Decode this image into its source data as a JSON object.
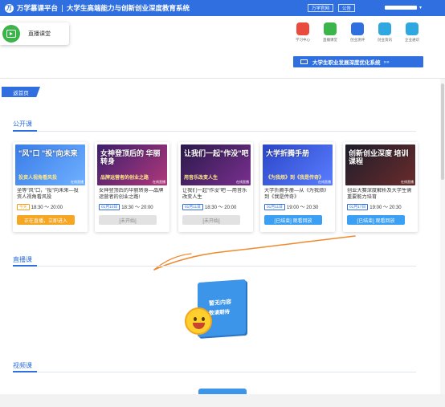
{
  "topbar": {
    "logo_letter": "万",
    "brand": "万学慕课平台",
    "system": "大学生高端能力与创新创业深度教育系统",
    "btn_site": "万学官网",
    "btn_notice": "公告"
  },
  "header": {
    "classroom_label": "直播课堂",
    "nav": [
      {
        "label": "学习中心",
        "color": "#e94b3c",
        "icon": "learning-center-icon"
      },
      {
        "label": "直播课堂",
        "color": "#39b54a",
        "icon": "live-classroom-icon"
      },
      {
        "label": "创业测评",
        "color": "#2f6fe0",
        "icon": "assessment-icon"
      },
      {
        "label": "创业资讯",
        "color": "#2fa7e0",
        "icon": "news-icon"
      },
      {
        "label": "企业通识",
        "color": "#2fa7e0",
        "icon": "enterprise-icon"
      }
    ],
    "banner": "大学生职业发展深度优化系统",
    "banner_arrows": "»»"
  },
  "content": {
    "back": "返首页",
    "public_title": "公开课",
    "live_title": "直播课",
    "video_title": "视频课",
    "empty_line1": "暂无内容",
    "empty_line2": "敬请期待",
    "cards": [
      {
        "thumb_title": "\"风\"口 \"投\"向未来",
        "thumb_sub": "投资人视角看风投",
        "thumb_tag": "在线直播",
        "desc": "坐等\"风\"口，\"投\"向未来—投资人视角看风投",
        "date": "今天",
        "time": "18:30 ～ 20:00",
        "btn": "正在直播，立即进入",
        "bg": "linear-gradient(135deg,#3a7de8,#6fb0ff)"
      },
      {
        "thumb_title": "女神登顶后的 华丽转身",
        "thumb_sub": "品牌运营者的创业之路",
        "thumb_tag": "在线直播",
        "desc": "女神登顶后的华丽转身—品牌运营者的创业之路!",
        "date": "01月10日",
        "time": "18:30 ～ 20:00",
        "btn": "[未开始]",
        "bg": "linear-gradient(135deg,#3d1f6e,#b0387a)"
      },
      {
        "thumb_title": "让我们一起\"作没\"吧",
        "thumb_sub": "用音乐改变人生",
        "thumb_tag": "在线直播",
        "desc": "让我们一起\"作没\"吧 —用音乐改变人生",
        "date": "01月11日",
        "time": "18:30 ～ 20:00",
        "btn": "[未开始]",
        "bg": "linear-gradient(135deg,#2a1a4a,#7a2f8f)"
      },
      {
        "thumb_title": "大学折腾手册",
        "thumb_sub": "《为我烦》到《我是传奇》",
        "thumb_tag": "在线直播",
        "desc": "大学折腾手册—从《为我烦》到《我是传奇》",
        "date": "01月11日",
        "time": "19:00 ～ 20:30",
        "btn": "[已结束] 观看回放",
        "bg": "linear-gradient(135deg,#2b46c8,#5a7dff)"
      },
      {
        "thumb_title": "创新创业深度 培训课程",
        "thumb_sub": "",
        "thumb_tag": "在线直播",
        "desc": "创业大赛深度解析及大学生需重要能力培育",
        "date": "01月17日",
        "time": "19:00 ～ 20:30",
        "btn": "[已结束] 观看回放",
        "bg": "linear-gradient(135deg,#1d1d2b,#6a2b2b)"
      }
    ]
  }
}
